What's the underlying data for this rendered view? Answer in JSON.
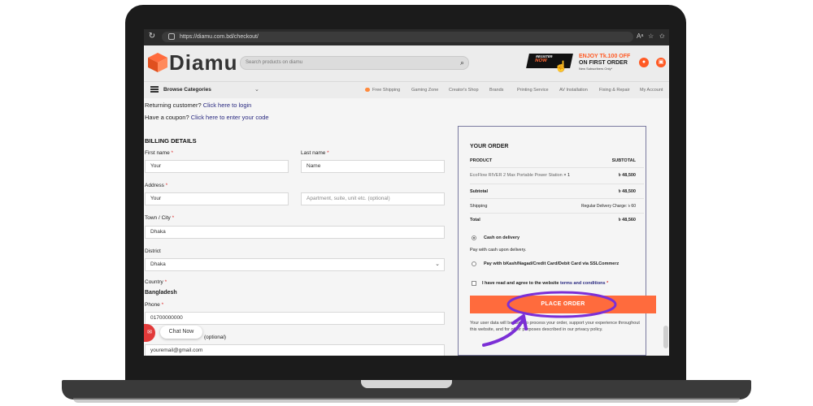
{
  "browser": {
    "url": "https://diamu.com.bd/checkout/"
  },
  "site": {
    "logo_text": "Diamu",
    "search_placeholder": "Search products on diamu",
    "promo": {
      "badge_line1": "REGISTER",
      "badge_line2": "NOW",
      "line1": "ENJOY Tk.100 OFF",
      "line2": "ON FIRST ORDER",
      "line3": "New Subscribers Only*"
    }
  },
  "nav": {
    "browse_label": "Browse Categories",
    "links": [
      "Free Shipping",
      "Gaming Zone",
      "Creator's Shop",
      "Brands",
      "Printing Service",
      "AV Installation",
      "Fixing & Repair",
      "My Account"
    ]
  },
  "notices": {
    "returning_prefix": "Returning customer?",
    "returning_link": "Click here to login",
    "coupon_prefix": "Have a coupon?",
    "coupon_link": "Click here to enter your code"
  },
  "billing": {
    "heading": "BILLING DETAILS",
    "first_name": {
      "label": "First name",
      "value": "Your"
    },
    "last_name": {
      "label": "Last name",
      "value": "Name"
    },
    "address": {
      "label": "Address",
      "value": "Your",
      "placeholder2": "Apartment, suite, unit etc. (optional)"
    },
    "town": {
      "label": "Town / City",
      "value": "Dhaka"
    },
    "district": {
      "label": "District",
      "value": "Dhaka"
    },
    "country": {
      "label": "Country",
      "value": "Bangladesh"
    },
    "phone": {
      "label": "Phone",
      "value": "01700000000"
    },
    "email": {
      "label": "(optional)",
      "value": "youremail@gmail.com"
    },
    "required_mark": "*"
  },
  "order": {
    "heading": "YOUR ORDER",
    "col_product": "PRODUCT",
    "col_subtotal": "SUBTOTAL",
    "item_name": "EcoFlow RIVER 2 Max Portable Power Station",
    "item_qty": "× 1",
    "item_price": "৳ 48,500",
    "subtotal_label": "Subtotal",
    "subtotal_value": "৳ 48,500",
    "shipping_label": "Shipping",
    "shipping_value": "Regular Delivery Charge: ৳ 60",
    "total_label": "Total",
    "total_value": "৳ 48,560",
    "cod_label": "Cash on delivery",
    "cod_desc": "Pay with cash upon delivery.",
    "online_label": "Pay with bKash/Nagad/Credit Card/Debit Card via SSLCommerz",
    "terms_prefix": "I have read and agree to the website",
    "terms_link": "terms and conditions",
    "terms_req": "*",
    "button": "PLACE ORDER",
    "policy_text": "Your user data will be used to process your order, support your experience throughout this website, and for other purposes described in our privacy policy."
  },
  "chat": {
    "label": "Chat Now"
  },
  "colors": {
    "accent": "#ff6b3d",
    "annotation": "#7b2fd6",
    "link": "#2a2a80"
  }
}
